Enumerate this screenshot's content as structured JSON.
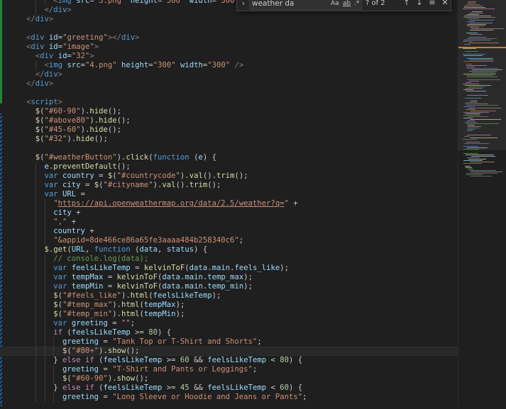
{
  "editor": {
    "lines": [
      [
        [
          "      ",
          "t-pl"
        ],
        [
          "<",
          "t-tag"
        ],
        [
          "img",
          "t-name"
        ],
        [
          " ",
          "t-pl"
        ],
        [
          "src",
          "t-attr"
        ],
        [
          "=",
          "t-pl"
        ],
        [
          "\"3.png\"",
          "t-str"
        ],
        [
          " ",
          "t-pl"
        ],
        [
          "height",
          "t-attr"
        ],
        [
          "=",
          "t-pl"
        ],
        [
          "\"300\"",
          "t-str"
        ],
        [
          " ",
          "t-pl"
        ],
        [
          "width",
          "t-attr"
        ],
        [
          "=",
          "t-pl"
        ],
        [
          "\"300\"",
          "t-str"
        ],
        [
          " />",
          "t-tag"
        ]
      ],
      [
        [
          "    ",
          "t-pl"
        ],
        [
          "</",
          "t-tag"
        ],
        [
          "div",
          "t-name"
        ],
        [
          ">",
          "t-tag"
        ]
      ],
      [
        [
          "",
          "t-pl"
        ],
        [
          "</",
          "t-tag"
        ],
        [
          "div",
          "t-name"
        ],
        [
          ">",
          "t-tag"
        ]
      ],
      [
        [
          "",
          "t-pl"
        ]
      ],
      [
        [
          "",
          "t-pl"
        ],
        [
          "<",
          "t-tag"
        ],
        [
          "div",
          "t-name"
        ],
        [
          " ",
          "t-pl"
        ],
        [
          "id",
          "t-attr"
        ],
        [
          "=",
          "t-pl"
        ],
        [
          "\"greeting\"",
          "t-str"
        ],
        [
          "></",
          "t-tag"
        ],
        [
          "div",
          "t-name"
        ],
        [
          ">",
          "t-tag"
        ]
      ],
      [
        [
          "",
          "t-pl"
        ],
        [
          "<",
          "t-tag"
        ],
        [
          "div",
          "t-name"
        ],
        [
          " ",
          "t-pl"
        ],
        [
          "id",
          "t-attr"
        ],
        [
          "=",
          "t-pl"
        ],
        [
          "\"image\"",
          "t-str"
        ],
        [
          ">",
          "t-tag"
        ]
      ],
      [
        [
          "  ",
          "t-pl"
        ],
        [
          "<",
          "t-tag"
        ],
        [
          "div",
          "t-name"
        ],
        [
          " ",
          "t-pl"
        ],
        [
          "id",
          "t-attr"
        ],
        [
          "=",
          "t-pl"
        ],
        [
          "\"32\"",
          "t-str"
        ],
        [
          ">",
          "t-tag"
        ]
      ],
      [
        [
          "    ",
          "t-pl"
        ],
        [
          "<",
          "t-tag"
        ],
        [
          "img",
          "t-name"
        ],
        [
          " ",
          "t-pl"
        ],
        [
          "src",
          "t-attr"
        ],
        [
          "=",
          "t-pl"
        ],
        [
          "\"4.png\"",
          "t-str"
        ],
        [
          " ",
          "t-pl"
        ],
        [
          "height",
          "t-attr"
        ],
        [
          "=",
          "t-pl"
        ],
        [
          "\"300\"",
          "t-str"
        ],
        [
          " ",
          "t-pl"
        ],
        [
          "width",
          "t-attr"
        ],
        [
          "=",
          "t-pl"
        ],
        [
          "\"300\"",
          "t-str"
        ],
        [
          " />",
          "t-tag"
        ]
      ],
      [
        [
          "  ",
          "t-pl"
        ],
        [
          "</",
          "t-tag"
        ],
        [
          "div",
          "t-name"
        ],
        [
          ">",
          "t-tag"
        ]
      ],
      [
        [
          "",
          "t-pl"
        ],
        [
          "</",
          "t-tag"
        ],
        [
          "div",
          "t-name"
        ],
        [
          ">",
          "t-tag"
        ]
      ],
      [
        [
          "",
          "t-pl"
        ]
      ],
      [
        [
          "",
          "t-pl"
        ],
        [
          "<",
          "t-tag"
        ],
        [
          "script",
          "t-name"
        ],
        [
          ">",
          "t-tag"
        ]
      ],
      [
        [
          "  ",
          "t-pl"
        ],
        [
          "$",
          "t-fn"
        ],
        [
          "(",
          "t-pl"
        ],
        [
          "\"#60-90\"",
          "t-str"
        ],
        [
          ").",
          "t-pl"
        ],
        [
          "hide",
          "t-fn"
        ],
        [
          "();",
          "t-pl"
        ]
      ],
      [
        [
          "  ",
          "t-pl"
        ],
        [
          "$",
          "t-fn"
        ],
        [
          "(",
          "t-pl"
        ],
        [
          "\"#above80\"",
          "t-str"
        ],
        [
          ").",
          "t-pl"
        ],
        [
          "hide",
          "t-fn"
        ],
        [
          "();",
          "t-pl"
        ]
      ],
      [
        [
          "  ",
          "t-pl"
        ],
        [
          "$",
          "t-fn"
        ],
        [
          "(",
          "t-pl"
        ],
        [
          "\"#45-60\"",
          "t-str"
        ],
        [
          ").",
          "t-pl"
        ],
        [
          "hide",
          "t-fn"
        ],
        [
          "();",
          "t-pl"
        ]
      ],
      [
        [
          "  ",
          "t-pl"
        ],
        [
          "$",
          "t-fn"
        ],
        [
          "(",
          "t-pl"
        ],
        [
          "\"#32\"",
          "t-str"
        ],
        [
          ").",
          "t-pl"
        ],
        [
          "hide",
          "t-fn"
        ],
        [
          "();",
          "t-pl"
        ]
      ],
      [
        [
          "",
          "t-pl"
        ]
      ],
      [
        [
          "  ",
          "t-pl"
        ],
        [
          "$",
          "t-fn"
        ],
        [
          "(",
          "t-pl"
        ],
        [
          "\"#weatherButton\"",
          "t-str"
        ],
        [
          ").",
          "t-pl"
        ],
        [
          "click",
          "t-fn"
        ],
        [
          "(",
          "t-pl"
        ],
        [
          "function",
          "t-kw"
        ],
        [
          " (",
          "t-pl"
        ],
        [
          "e",
          "t-var"
        ],
        [
          ") {",
          "t-pl"
        ]
      ],
      [
        [
          "    ",
          "t-pl"
        ],
        [
          "e",
          "t-var"
        ],
        [
          ".",
          "t-pl"
        ],
        [
          "preventDefault",
          "t-fn"
        ],
        [
          "();",
          "t-pl"
        ]
      ],
      [
        [
          "    ",
          "t-pl"
        ],
        [
          "var",
          "t-kw"
        ],
        [
          " ",
          "t-pl"
        ],
        [
          "country",
          "t-var"
        ],
        [
          " = ",
          "t-pl"
        ],
        [
          "$",
          "t-fn"
        ],
        [
          "(",
          "t-pl"
        ],
        [
          "\"#countrycode\"",
          "t-str"
        ],
        [
          ").",
          "t-pl"
        ],
        [
          "val",
          "t-fn"
        ],
        [
          "().",
          "t-pl"
        ],
        [
          "trim",
          "t-fn"
        ],
        [
          "();",
          "t-pl"
        ]
      ],
      [
        [
          "    ",
          "t-pl"
        ],
        [
          "var",
          "t-kw"
        ],
        [
          " ",
          "t-pl"
        ],
        [
          "city",
          "t-var"
        ],
        [
          " = ",
          "t-pl"
        ],
        [
          "$",
          "t-fn"
        ],
        [
          "(",
          "t-pl"
        ],
        [
          "\"#cityname\"",
          "t-str"
        ],
        [
          ").",
          "t-pl"
        ],
        [
          "val",
          "t-fn"
        ],
        [
          "().",
          "t-pl"
        ],
        [
          "trim",
          "t-fn"
        ],
        [
          "();",
          "t-pl"
        ]
      ],
      [
        [
          "    ",
          "t-pl"
        ],
        [
          "var",
          "t-kw"
        ],
        [
          " ",
          "t-pl"
        ],
        [
          "URL",
          "t-var"
        ],
        [
          " =",
          "t-pl"
        ]
      ],
      [
        [
          "      ",
          "t-pl"
        ],
        [
          "\"",
          "t-str"
        ],
        [
          "https://api.openweathermap.org/data/2.5/weather?q=",
          "t-url"
        ],
        [
          "\"",
          "t-str"
        ],
        [
          " +",
          "t-pl"
        ]
      ],
      [
        [
          "      ",
          "t-pl"
        ],
        [
          "city",
          "t-var"
        ],
        [
          " +",
          "t-pl"
        ]
      ],
      [
        [
          "      ",
          "t-pl"
        ],
        [
          "\",\"",
          "t-str"
        ],
        [
          " +",
          "t-pl"
        ]
      ],
      [
        [
          "      ",
          "t-pl"
        ],
        [
          "country",
          "t-var"
        ],
        [
          " +",
          "t-pl"
        ]
      ],
      [
        [
          "      ",
          "t-pl"
        ],
        [
          "\"&appid=8de466ce86a65fe3aaaa484b258340c6\"",
          "t-str"
        ],
        [
          ";",
          "t-pl"
        ]
      ],
      [
        [
          "    ",
          "t-pl"
        ],
        [
          "$",
          "t-fn"
        ],
        [
          ".",
          "t-pl"
        ],
        [
          "get",
          "t-fn"
        ],
        [
          "(",
          "t-pl"
        ],
        [
          "URL",
          "t-var"
        ],
        [
          ", ",
          "t-pl"
        ],
        [
          "function",
          "t-kw"
        ],
        [
          " (",
          "t-pl"
        ],
        [
          "data",
          "t-var"
        ],
        [
          ", ",
          "t-pl"
        ],
        [
          "status",
          "t-var"
        ],
        [
          ") {",
          "t-pl"
        ]
      ],
      [
        [
          "      ",
          "t-pl"
        ],
        [
          "// console.log(data);",
          "t-com"
        ]
      ],
      [
        [
          "      ",
          "t-pl"
        ],
        [
          "var",
          "t-kw"
        ],
        [
          " ",
          "t-pl"
        ],
        [
          "feelsLikeTemp",
          "t-var"
        ],
        [
          " = ",
          "t-pl"
        ],
        [
          "kelvinToF",
          "t-fn"
        ],
        [
          "(",
          "t-pl"
        ],
        [
          "data",
          "t-var"
        ],
        [
          ".",
          "t-pl"
        ],
        [
          "main",
          "t-var"
        ],
        [
          ".",
          "t-pl"
        ],
        [
          "feels_like",
          "t-var"
        ],
        [
          ");",
          "t-pl"
        ]
      ],
      [
        [
          "      ",
          "t-pl"
        ],
        [
          "var",
          "t-kw"
        ],
        [
          " ",
          "t-pl"
        ],
        [
          "tempMax",
          "t-var"
        ],
        [
          " = ",
          "t-pl"
        ],
        [
          "kelvinToF",
          "t-fn"
        ],
        [
          "(",
          "t-pl"
        ],
        [
          "data",
          "t-var"
        ],
        [
          ".",
          "t-pl"
        ],
        [
          "main",
          "t-var"
        ],
        [
          ".",
          "t-pl"
        ],
        [
          "temp_max",
          "t-var"
        ],
        [
          ");",
          "t-pl"
        ]
      ],
      [
        [
          "      ",
          "t-pl"
        ],
        [
          "var",
          "t-kw"
        ],
        [
          " ",
          "t-pl"
        ],
        [
          "tempMin",
          "t-var"
        ],
        [
          " = ",
          "t-pl"
        ],
        [
          "kelvinToF",
          "t-fn"
        ],
        [
          "(",
          "t-pl"
        ],
        [
          "data",
          "t-var"
        ],
        [
          ".",
          "t-pl"
        ],
        [
          "main",
          "t-var"
        ],
        [
          ".",
          "t-pl"
        ],
        [
          "temp_min",
          "t-var"
        ],
        [
          ");",
          "t-pl"
        ]
      ],
      [
        [
          "      ",
          "t-pl"
        ],
        [
          "$",
          "t-fn"
        ],
        [
          "(",
          "t-pl"
        ],
        [
          "\"#feels_like\"",
          "t-str"
        ],
        [
          ").",
          "t-pl"
        ],
        [
          "html",
          "t-fn"
        ],
        [
          "(",
          "t-pl"
        ],
        [
          "feelsLikeTemp",
          "t-var"
        ],
        [
          ");",
          "t-pl"
        ]
      ],
      [
        [
          "      ",
          "t-pl"
        ],
        [
          "$",
          "t-fn"
        ],
        [
          "(",
          "t-pl"
        ],
        [
          "\"#temp_max\"",
          "t-str"
        ],
        [
          ").",
          "t-pl"
        ],
        [
          "html",
          "t-fn"
        ],
        [
          "(",
          "t-pl"
        ],
        [
          "tempMax",
          "t-var"
        ],
        [
          ");",
          "t-pl"
        ]
      ],
      [
        [
          "      ",
          "t-pl"
        ],
        [
          "$",
          "t-fn"
        ],
        [
          "(",
          "t-pl"
        ],
        [
          "\"#temp_min\"",
          "t-str"
        ],
        [
          ").",
          "t-pl"
        ],
        [
          "html",
          "t-fn"
        ],
        [
          "(",
          "t-pl"
        ],
        [
          "tempMin",
          "t-var"
        ],
        [
          ");",
          "t-pl"
        ]
      ],
      [
        [
          "      ",
          "t-pl"
        ],
        [
          "var",
          "t-kw"
        ],
        [
          " ",
          "t-pl"
        ],
        [
          "greeting",
          "t-var"
        ],
        [
          " = ",
          "t-pl"
        ],
        [
          "\"\"",
          "t-str"
        ],
        [
          ";",
          "t-pl"
        ]
      ],
      [
        [
          "      ",
          "t-pl"
        ],
        [
          "if",
          "t-ctl"
        ],
        [
          " (",
          "t-pl"
        ],
        [
          "feelsLikeTemp",
          "t-var"
        ],
        [
          " >= ",
          "t-pl"
        ],
        [
          "80",
          "t-num"
        ],
        [
          ") {",
          "t-pl"
        ]
      ],
      [
        [
          "        ",
          "t-pl"
        ],
        [
          "greeting",
          "t-var"
        ],
        [
          " = ",
          "t-pl"
        ],
        [
          "\"Tank Top or T-Shirt and Shorts\"",
          "t-str"
        ],
        [
          ";",
          "t-pl"
        ]
      ],
      [
        [
          "        ",
          "t-pl"
        ],
        [
          "$",
          "t-fn"
        ],
        [
          "(",
          "t-pl"
        ],
        [
          "\"#80+\"",
          "t-str"
        ],
        [
          ").",
          "t-pl"
        ],
        [
          "show",
          "t-fn"
        ],
        [
          "();",
          "t-pl"
        ]
      ],
      [
        [
          "      ",
          "t-pl"
        ],
        [
          "} ",
          "t-pl"
        ],
        [
          "else",
          "t-ctl"
        ],
        [
          " ",
          "t-pl"
        ],
        [
          "if",
          "t-ctl"
        ],
        [
          " (",
          "t-pl"
        ],
        [
          "feelsLikeTemp",
          "t-var"
        ],
        [
          " >= ",
          "t-pl"
        ],
        [
          "60",
          "t-num"
        ],
        [
          " && ",
          "t-pl"
        ],
        [
          "feelsLikeTemp",
          "t-var"
        ],
        [
          " < ",
          "t-pl"
        ],
        [
          "80",
          "t-num"
        ],
        [
          ") {",
          "t-pl"
        ]
      ],
      [
        [
          "        ",
          "t-pl"
        ],
        [
          "greeting",
          "t-var"
        ],
        [
          " = ",
          "t-pl"
        ],
        [
          "\"T-Shirt and Pants or Leggings\"",
          "t-str"
        ],
        [
          ";",
          "t-pl"
        ]
      ],
      [
        [
          "        ",
          "t-pl"
        ],
        [
          "$",
          "t-fn"
        ],
        [
          "(",
          "t-pl"
        ],
        [
          "\"#60-90\"",
          "t-str"
        ],
        [
          ").",
          "t-pl"
        ],
        [
          "show",
          "t-fn"
        ],
        [
          "();",
          "t-pl"
        ]
      ],
      [
        [
          "      ",
          "t-pl"
        ],
        [
          "} ",
          "t-pl"
        ],
        [
          "else",
          "t-ctl"
        ],
        [
          " ",
          "t-pl"
        ],
        [
          "if",
          "t-ctl"
        ],
        [
          " (",
          "t-pl"
        ],
        [
          "feelsLikeTemp",
          "t-var"
        ],
        [
          " >= ",
          "t-pl"
        ],
        [
          "45",
          "t-num"
        ],
        [
          " && ",
          "t-pl"
        ],
        [
          "feelsLikeTemp",
          "t-var"
        ],
        [
          " < ",
          "t-pl"
        ],
        [
          "60",
          "t-num"
        ],
        [
          ") {",
          "t-pl"
        ]
      ],
      [
        [
          "        ",
          "t-pl"
        ],
        [
          "greeting",
          "t-var"
        ],
        [
          " = ",
          "t-pl"
        ],
        [
          "\"Long Sleeve or Hoodie and Jeans or Pants\"",
          "t-str"
        ],
        [
          ";",
          "t-pl"
        ]
      ]
    ],
    "highlighted_line": 38
  },
  "find_widget": {
    "toggle_icon": "›",
    "search_value": "weather da",
    "match_case_label": "Aa",
    "whole_word_label": "ab",
    "regex_label": ".*",
    "match_count": "? of 2",
    "prev_icon": "↑",
    "next_icon": "↓",
    "selection_icon": "≡",
    "close_icon": "✕"
  },
  "colors": {
    "background": "#1f1f1f",
    "gutter_modified": "#1f7a3a",
    "gutter_changed": "#1b5fa0"
  }
}
